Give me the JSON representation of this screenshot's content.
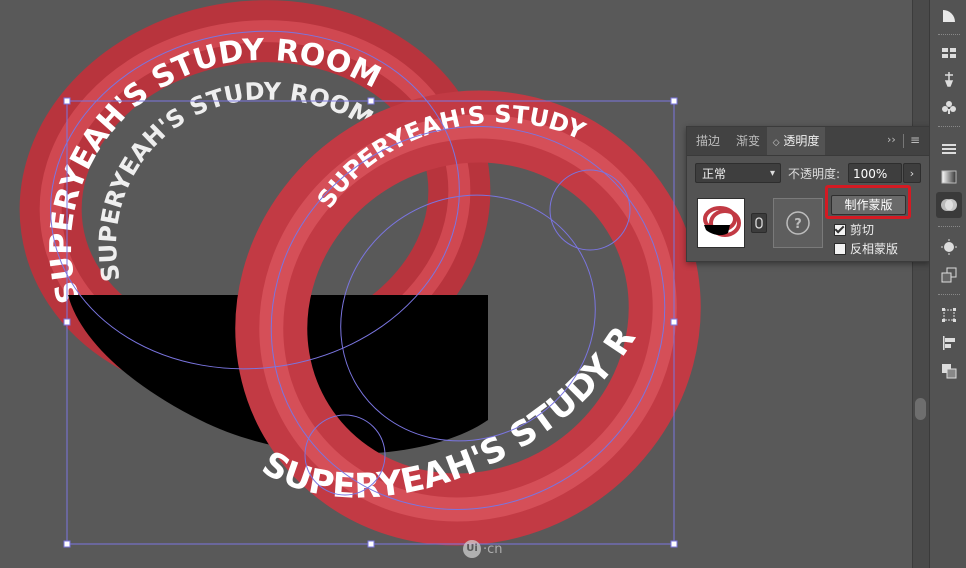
{
  "artwork": {
    "ring_text": "SUPERYEAH'S STUDY ROOM",
    "ring_color": "#d9444c",
    "ring_shadow": "#9e2730",
    "ring_text_color": "#ffffff",
    "selection_color": "#7a75e0"
  },
  "panel": {
    "tabs": [
      {
        "label": "描边"
      },
      {
        "label": "渐变"
      },
      {
        "label": "透明度"
      }
    ],
    "tab_arrows": "››",
    "tab_menu": "≡",
    "blend_mode": "正常",
    "opacity_label": "不透明度:",
    "opacity_value": "100%",
    "make_mask_label": "制作蒙版",
    "clip_label": "剪切",
    "clip_checked": true,
    "invert_label": "反相蒙版",
    "invert_checked": false,
    "mask_placeholder_icon": "question-circle-icon",
    "highlight_color": "#d41a23"
  },
  "toolstrip": {
    "icons": [
      "color-guide-icon",
      "swatches-icon",
      "brushes-icon",
      "symbols-icon",
      "stroke-icon",
      "gradient-icon",
      "transparency-icon",
      "appearance-icon",
      "graphic-styles-icon",
      "transform-icon",
      "align-icon",
      "pathfinder-icon"
    ]
  },
  "watermark": {
    "logo": "Ui",
    "text": "·cn"
  }
}
